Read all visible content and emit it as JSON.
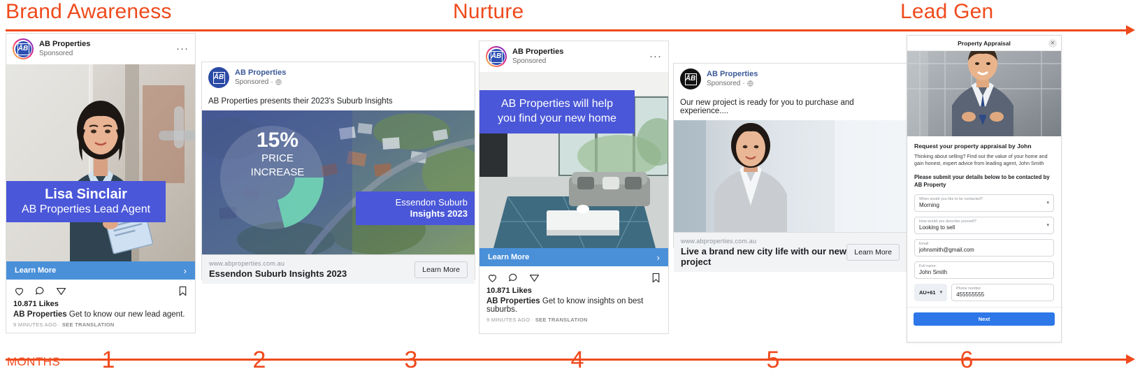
{
  "funnel": {
    "stages": [
      {
        "label": "Brand Awareness"
      },
      {
        "label": "Nurture"
      },
      {
        "label": "Lead Gen"
      }
    ],
    "timeline_label": "MONTHS",
    "months": [
      "1",
      "2",
      "3",
      "4",
      "5",
      "6"
    ],
    "accent_color": "#ef4a1c"
  },
  "card1": {
    "platform": "instagram",
    "account": "AB Properties",
    "sponsored": "Sponsored",
    "more_icon": "···",
    "overlay_name": "Lisa Sinclair",
    "overlay_role": "AB Properties Lead Agent",
    "cta": "Learn More",
    "cta_chevron": "›",
    "likes": "10.871 Likes",
    "caption_author": "AB Properties",
    "caption_text": "Get to know our new lead agent.",
    "time_ago": "9 MINUTES AGO",
    "separator": "·",
    "translate": "SEE TRANSLATION",
    "logo_text": "ĀB",
    "banner_color": "#4a57d8",
    "cta_color": "#4a90d9"
  },
  "card2": {
    "platform": "facebook",
    "account": "AB Properties",
    "sponsored": "Sponsored",
    "globe_icon": "🌐",
    "primary_text": "AB Properties presents their 2023's Suburb Insights",
    "stat_value": "15%",
    "stat_line1": "PRICE",
    "stat_line2": "INCREASE",
    "overlay_line1": "Essendon Suburb",
    "overlay_line2": "Insights 2023",
    "url": "www.abproperties.com.au",
    "link_title": "Essendon Suburb Insights 2023",
    "cta": "Learn More",
    "logo_text": "ĀB",
    "banner_color": "#4a57d8"
  },
  "card3": {
    "platform": "instagram",
    "account": "AB Properties",
    "sponsored": "Sponsored",
    "more_icon": "···",
    "overlay_line1": "AB Properties will help",
    "overlay_line2": "you find your new home",
    "cta": "Learn More",
    "cta_chevron": "›",
    "likes": "10.871 Likes",
    "caption_author": "AB Properties",
    "caption_text": "Get to know insights on best suburbs.",
    "time_ago": "9 MINUTES AGO",
    "separator": "·",
    "translate": "SEE TRANSLATION",
    "logo_text": "ĀB",
    "banner_color": "#4a57d8",
    "cta_color": "#4a90d9"
  },
  "card4": {
    "platform": "facebook",
    "account": "AB Properties",
    "sponsored": "Sponsored",
    "globe_icon": "🌐",
    "primary_text": "Our new project is ready for you to purchase and experience....",
    "url": "www.abproperties.com.au",
    "link_title": "Live a brand new city life with our new project",
    "cta": "Learn More",
    "logo_text": "ĀB"
  },
  "card5": {
    "platform": "lead-form",
    "title": "Property Appraisal",
    "close_icon": "✕",
    "heading": "Request your property appraisal by John",
    "description": "Thinking about selling? Find out the value of your home and gain honest, expert advice from leading agent, John Smith",
    "subheading": "Please submit your details below to be contacted by AB Property",
    "fields": [
      {
        "label": "When would you like to be contacted?",
        "value": "Morning",
        "type": "select"
      },
      {
        "label": "How would you describe yourself?",
        "value": "Looking to sell",
        "type": "select"
      },
      {
        "label": "Email",
        "value": "johnsmith@gmail.com",
        "type": "text"
      },
      {
        "label": "Full name",
        "value": "John Smith",
        "type": "text"
      }
    ],
    "country_code": "AU+61",
    "country_caret": "▾",
    "phone_label": "Phone number",
    "phone_value": "455555555",
    "submit": "Next",
    "submit_color": "#2d77e8"
  }
}
